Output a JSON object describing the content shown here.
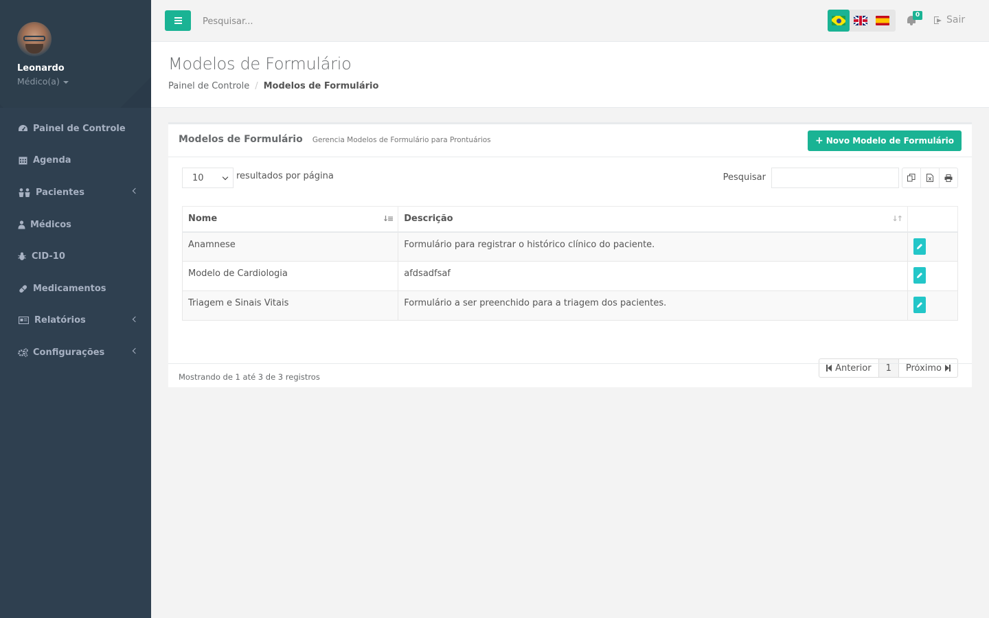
{
  "sidebar": {
    "user": {
      "name": "Leonardo",
      "role": "Médico(a)"
    },
    "items": [
      {
        "label": "Painel de Controle",
        "icon": "dashboard-icon"
      },
      {
        "label": "Agenda",
        "icon": "calendar-icon"
      },
      {
        "label": "Pacientes",
        "icon": "users-icon",
        "has_children": true
      },
      {
        "label": "Médicos",
        "icon": "user-md-icon"
      },
      {
        "label": "CID-10",
        "icon": "bug-icon"
      },
      {
        "label": "Medicamentos",
        "icon": "pill-icon"
      },
      {
        "label": "Relatórios",
        "icon": "report-icon",
        "has_children": true
      },
      {
        "label": "Configurações",
        "icon": "cogs-icon",
        "has_children": true
      }
    ]
  },
  "topbar": {
    "search_placeholder": "Pesquisar...",
    "languages": [
      "pt-BR",
      "en-GB",
      "es-ES"
    ],
    "active_language": "pt-BR",
    "notification_count": "0",
    "logout_label": "Sair"
  },
  "heading": {
    "title": "Modelos de Formulário",
    "breadcrumb": {
      "parent": "Painel de Controle",
      "current": "Modelos de Formulário"
    }
  },
  "ibox": {
    "title": "Modelos de Formulário",
    "subtitle": "Gerencia Modelos de Formulário para Prontuários",
    "new_button": "Novo Modelo de Formulário",
    "page_length": "10",
    "page_length_label": "resultados por página",
    "filter_label": "Pesquisar",
    "columns": [
      "Nome",
      "Descrição"
    ],
    "rows": [
      {
        "nome": "Anamnese",
        "descricao": "Formulário para registrar o histórico clínico do paciente."
      },
      {
        "nome": "Modelo de Cardiologia",
        "descricao": "afdsadfsaf"
      },
      {
        "nome": "Triagem e Sinais Vitais",
        "descricao": "Formulário a ser preenchido para a triagem dos pacientes."
      }
    ],
    "pagination": {
      "prev": "Anterior",
      "page": "1",
      "next": "Próximo"
    },
    "footer": "Mostrando de 1 até 3 de 3 registros"
  },
  "colors": {
    "primary": "#1ab394",
    "info": "#23c6c8",
    "sidebar": "#2f4050"
  }
}
